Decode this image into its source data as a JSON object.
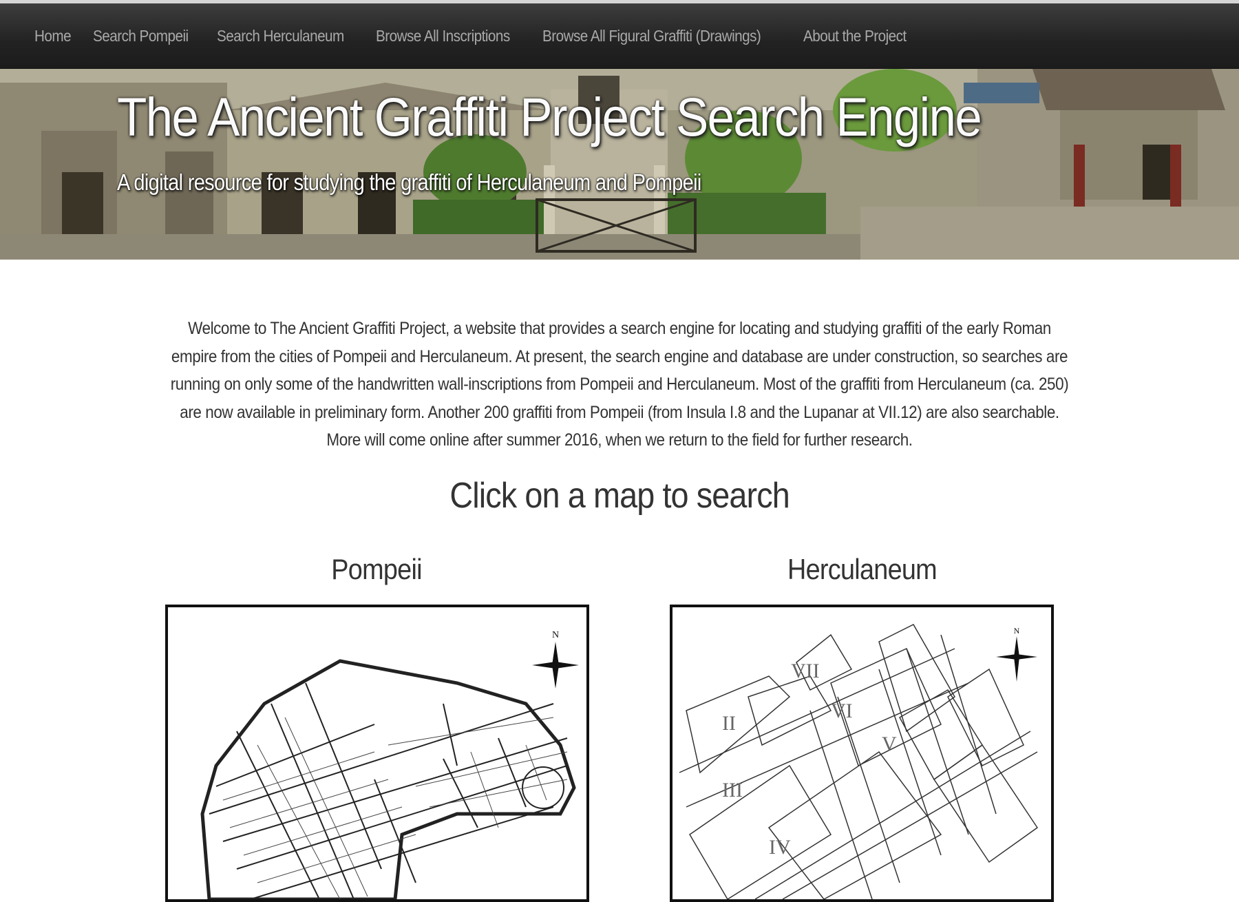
{
  "nav": {
    "items": [
      {
        "label": "Home"
      },
      {
        "label": "Search Pompeii"
      },
      {
        "label": "Search Herculaneum"
      },
      {
        "label": "Browse All Inscriptions"
      },
      {
        "label": "Browse All Figural Graffiti (Drawings)"
      },
      {
        "label": "About the Project"
      }
    ]
  },
  "banner": {
    "title": "The Ancient Graffiti Project Search Engine",
    "subtitle": "A digital resource for studying the graffiti of Herculaneum and Pompeii"
  },
  "intro": {
    "text": "Welcome to The Ancient Graffiti Project, a website that provides a search engine for locating and studying graffiti of the early Roman empire from the cities of Pompeii and Herculaneum. At present, the search engine and database are under construction, so searches are running on only some of the handwritten wall-inscriptions from Pompeii and Herculaneum. Most of the graffiti from Herculaneum (ca. 250) are now available in preliminary form. Another 200 graffiti from Pompeii (from Insula I.8 and the Lupanar at VII.12) are also searchable. More will come online after summer 2016, when we return to the field for further research."
  },
  "maps": {
    "heading": "Click on a map to search",
    "pompeii": {
      "title": "Pompeii",
      "north_label": "N"
    },
    "herculaneum": {
      "title": "Herculaneum",
      "north_label": "N",
      "insula_labels": [
        "VII",
        "II",
        "VI",
        "V",
        "III",
        "IV"
      ]
    }
  },
  "colors": {
    "navbar": "#222222",
    "nav_text": "#a9a9a9",
    "body_text": "#333333",
    "map_border": "#111111"
  }
}
